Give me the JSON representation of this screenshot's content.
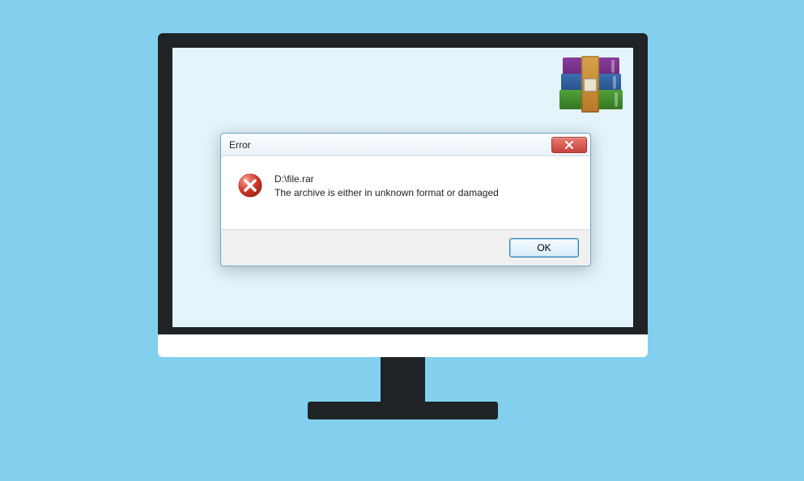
{
  "dialog": {
    "title": "Error",
    "file_path": "D:\\file.rar",
    "message": "The archive is either in unknown format or damaged",
    "ok_label": "OK"
  },
  "icons": {
    "winrar": "winrar-books-icon",
    "error": "error-circle-x",
    "close": "close-x"
  }
}
